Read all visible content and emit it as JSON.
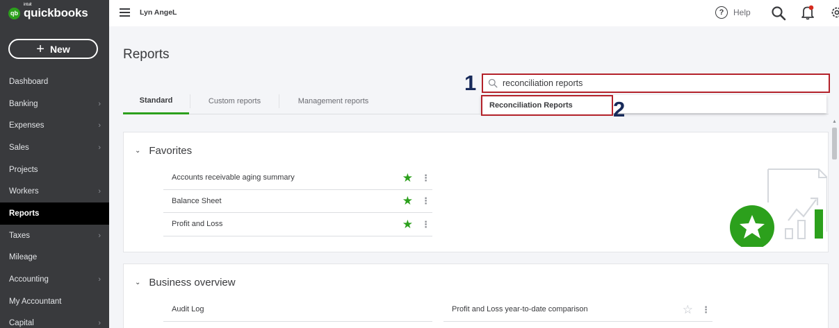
{
  "brand": {
    "intuit": "intuit",
    "name": "quickbooks",
    "mark": "qb",
    "color": "#2ca01c"
  },
  "sidebar": {
    "new_label": "New",
    "items": [
      {
        "label": "Dashboard",
        "chevron": false
      },
      {
        "label": "Banking",
        "chevron": true
      },
      {
        "label": "Expenses",
        "chevron": true
      },
      {
        "label": "Sales",
        "chevron": true
      },
      {
        "label": "Projects",
        "chevron": false
      },
      {
        "label": "Workers",
        "chevron": true
      },
      {
        "label": "Reports",
        "chevron": false,
        "active": true
      },
      {
        "label": "Taxes",
        "chevron": true
      },
      {
        "label": "Mileage",
        "chevron": false
      },
      {
        "label": "Accounting",
        "chevron": true
      },
      {
        "label": "My Accountant",
        "chevron": false
      },
      {
        "label": "Capital",
        "chevron": true
      }
    ]
  },
  "topbar": {
    "company": "Lyn AngeL",
    "help_label": "Help",
    "help_glyph": "?"
  },
  "page": {
    "title": "Reports"
  },
  "tabs": [
    {
      "label": "Standard",
      "active": true
    },
    {
      "label": "Custom reports"
    },
    {
      "label": "Management reports"
    }
  ],
  "search": {
    "value": "reconciliation reports"
  },
  "dropdown": {
    "items": [
      {
        "label": "Reconciliation Reports"
      }
    ]
  },
  "annotations": {
    "step1": "1",
    "step2": "2",
    "color": "#b32129"
  },
  "favorites": {
    "title": "Favorites",
    "rows": [
      {
        "label": "Accounts receivable aging summary",
        "favorite": true
      },
      {
        "label": "Balance Sheet",
        "favorite": true
      },
      {
        "label": "Profit and Loss",
        "favorite": true
      }
    ]
  },
  "business_overview": {
    "title": "Business overview",
    "left_rows": [
      {
        "label": "Audit Log",
        "favorite": false
      }
    ],
    "right_rows": [
      {
        "label": "Profit and Loss year-to-date comparison",
        "favorite": false
      }
    ]
  }
}
